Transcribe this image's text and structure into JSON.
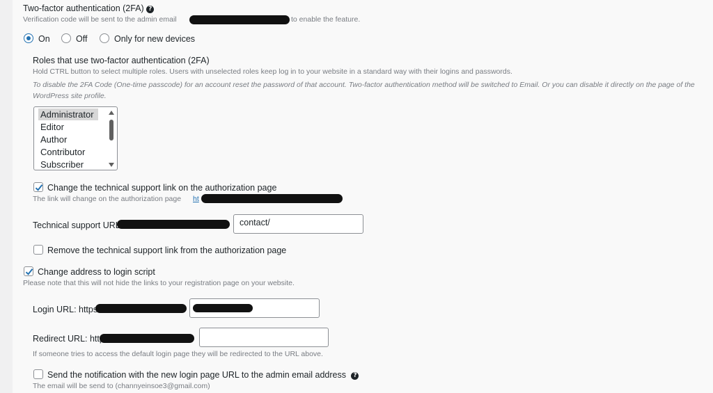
{
  "twofa": {
    "title": "Two-factor authentication (2FA)",
    "desc_prefix": "Verification code will be sent to the admin email",
    "desc_suffix": "to enable the feature.",
    "options": [
      "On",
      "Off",
      "Only for new devices"
    ],
    "selected": "On",
    "roles_title": "Roles that use two-factor authentication (2FA)",
    "roles_desc": "Hold CTRL button to select multiple roles. Users with unselected roles keep log in to your website in a standard way with their logins and passwords.",
    "roles_note": "To disable the 2FA Code (One-time passcode) for an account reset the password of that account. Two-factor authentication method will be switched to Email. Or you can disable it directly on the page of the WordPress site profile.",
    "roles": [
      "Administrator",
      "Editor",
      "Author",
      "Contributor",
      "Subscriber"
    ],
    "selected_role": "Administrator"
  },
  "support": {
    "change_label": "Change the technical support link on the authorization page",
    "change_checked": true,
    "change_desc": "The link will change on the authorization page",
    "link_prefix": "ht",
    "url_label": "Technical support URL:",
    "url_value": "contact/",
    "remove_label": "Remove the technical support link from the authorization page",
    "remove_checked": false
  },
  "login_script": {
    "label": "Change address to login script",
    "checked": true,
    "desc": "Please note that this will not hide the links to your registration page on your website.",
    "login_url_label": "Login URL: https:",
    "redirect_url_label": "Redirect URL: http",
    "redirect_desc": "If someone tries to access the default login page they will be redirected to the URL above.",
    "notify_label": "Send the notification with the new login page URL to the admin email address",
    "notify_checked": false,
    "notify_desc": "The email will be send to (channyeinsoe3@gmail.com)"
  },
  "icons": {
    "help": "question-circle-icon",
    "check": "checkmark-icon"
  },
  "colors": {
    "accent": "#2271b1",
    "text": "#1d2327",
    "muted": "#787c82",
    "redaction": "#111111"
  }
}
